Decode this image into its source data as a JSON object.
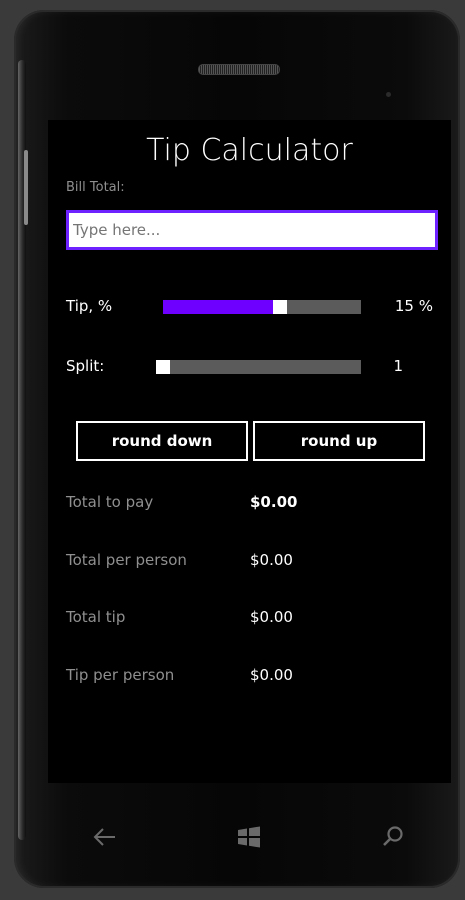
{
  "app": {
    "title": "Tip Calculator"
  },
  "bill": {
    "label": "Bill Total:",
    "placeholder": "Type here...",
    "value": ""
  },
  "tip": {
    "label": "Tip, %",
    "value_text": "15 %",
    "level_fraction": 0.6
  },
  "split": {
    "label": "Split:",
    "value_text": "1",
    "level_fraction": 0.0
  },
  "buttons": {
    "round_down": "round down",
    "round_up": "round up"
  },
  "results": [
    {
      "label": "Total to pay",
      "value": "$0.00",
      "bold": true
    },
    {
      "label": "Total per person",
      "value": "$0.00",
      "bold": false
    },
    {
      "label": "Total tip",
      "value": "$0.00",
      "bold": false
    },
    {
      "label": "Tip per person",
      "value": "$0.00",
      "bold": false
    }
  ],
  "nav": {
    "back_icon": "back-arrow-icon",
    "start_icon": "windows-start-icon",
    "search_icon": "search-icon"
  },
  "colors": {
    "accent": "#6e00ff",
    "input_border": "#6e22ff",
    "secondary_text": "#8f8f8f"
  }
}
